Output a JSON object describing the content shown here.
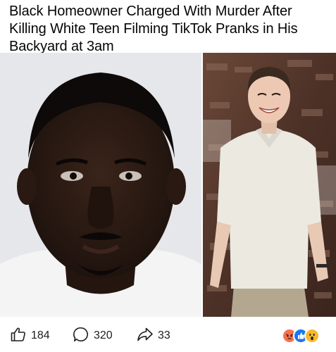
{
  "post": {
    "headline": "Black Homeowner Charged With Murder After Killing White Teen Filming TikTok Pranks in His Backyard at 3am"
  },
  "actions": {
    "likes": "184",
    "comments": "320",
    "shares": "33"
  },
  "reactions": [
    "angry",
    "like",
    "wow"
  ],
  "icons": {
    "like": "thumbs-up-icon",
    "comment": "comment-bubble-icon",
    "share": "share-arrow-icon"
  },
  "colors": {
    "text": "#050505",
    "icon": "#1c1e21",
    "react_angry": "#f7714e",
    "react_like": "#1877f2",
    "react_wow": "#f7b928"
  }
}
